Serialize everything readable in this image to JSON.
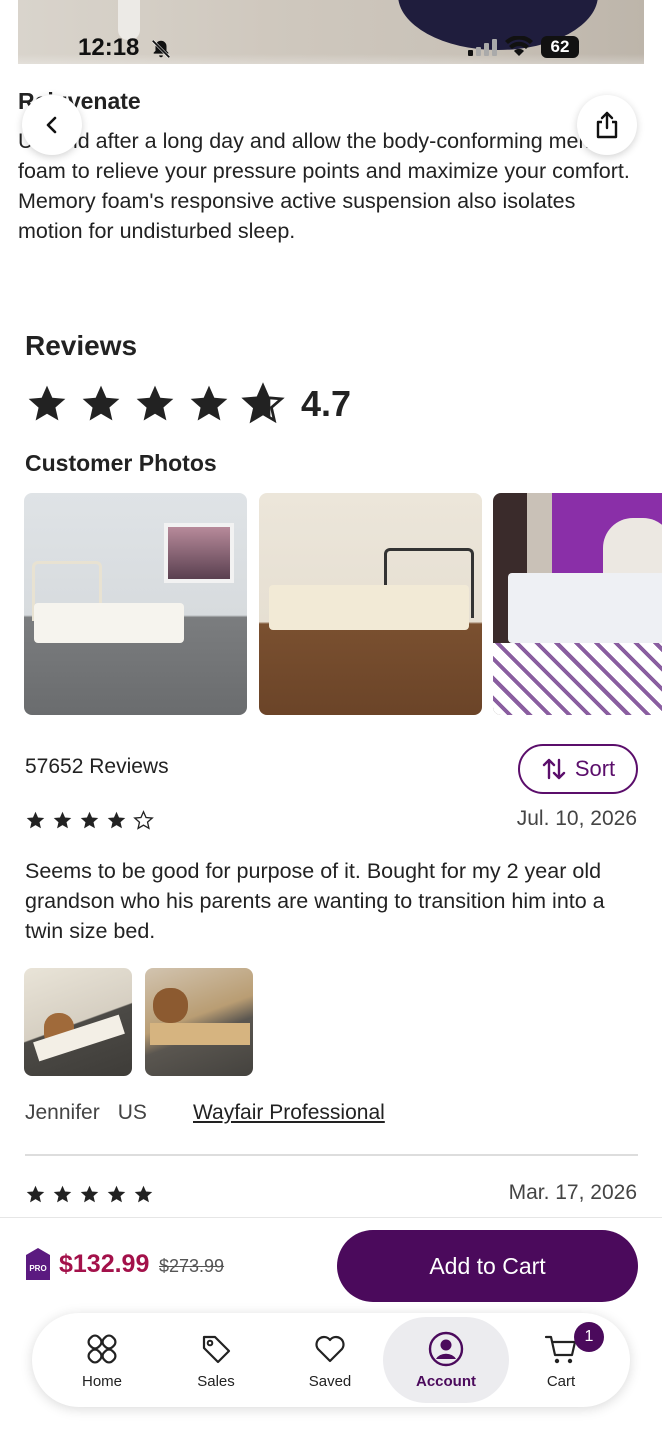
{
  "status_bar": {
    "time": "12:18",
    "battery": "62"
  },
  "description": {
    "title": "Rejuvenate",
    "text": "Unwind after a long day and allow the body-conforming memory foam to relieve your pressure points and maximize your comfort. Memory foam's responsive active suspension also isolates motion for undisturbed sleep."
  },
  "reviews": {
    "title": "Reviews",
    "average_rating": "4.7",
    "customer_photos_title": "Customer Photos",
    "count_label": "57652 Reviews",
    "sort_label": "Sort",
    "items": [
      {
        "stars": 4,
        "date": "Jul. 10, 2026",
        "body": "Seems to be good for purpose of it. Bought for my 2 year old grandson who his parents are wanting to transition him into a twin size bed.",
        "author": "Jennifer",
        "country": "US",
        "badge_link": "Wayfair Professional"
      },
      {
        "stars": 5,
        "date": "Mar. 17, 2026"
      }
    ]
  },
  "purchase": {
    "price": "$132.99",
    "original_price": "$273.99",
    "pro_badge": "PRO",
    "add_to_cart": "Add to Cart"
  },
  "tabbar": {
    "items": [
      {
        "label": "Home",
        "icon": "home-icon"
      },
      {
        "label": "Sales",
        "icon": "tag-icon"
      },
      {
        "label": "Saved",
        "icon": "heart-icon"
      },
      {
        "label": "Account",
        "icon": "account-icon",
        "active": true
      },
      {
        "label": "Cart",
        "icon": "cart-icon"
      }
    ],
    "cart_count": "1"
  },
  "colors": {
    "brand_purple": "#4b0a5c",
    "price_red": "#a3114a"
  }
}
